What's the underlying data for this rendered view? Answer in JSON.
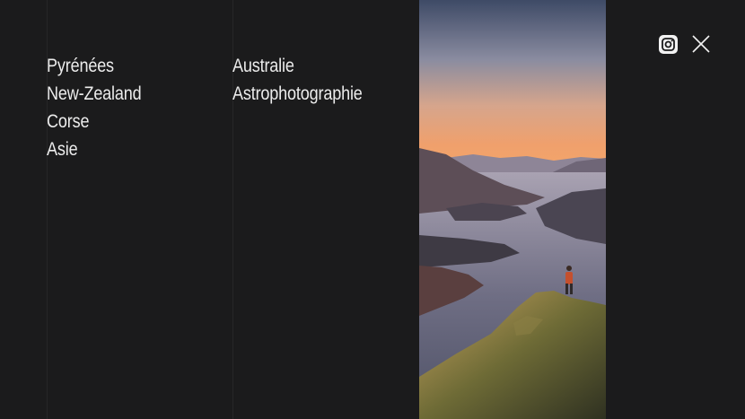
{
  "menu": {
    "column_1": [
      "Pyrénées",
      "New-Zealand",
      "Corse",
      "Asie"
    ],
    "column_2": [
      "Australie",
      "Astrophotographie"
    ]
  },
  "colors": {
    "background": "#1b1b1c",
    "text": "#ececec",
    "icon": "#f2f2f2"
  },
  "icons": {
    "social": "instagram-icon",
    "close": "close-icon"
  }
}
